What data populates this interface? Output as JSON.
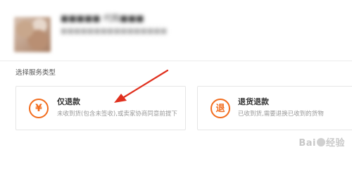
{
  "product": {
    "title": "■■■■■ 代购■■■",
    "spec": "■■■■■■■■■■■■■■■■"
  },
  "service_section": {
    "title": "选择服务类型"
  },
  "options": [
    {
      "icon": "refund-yen-icon",
      "icon_glyph": "¥",
      "title": "仅退款",
      "desc": "未收到货(包含未签收),或卖家协商同意前提下"
    },
    {
      "icon": "return-icon",
      "icon_glyph": "退",
      "title": "退货退款",
      "desc": "已收到货,需要退换已收到的货物"
    }
  ],
  "watermark": {
    "text_a": "Bai",
    "text_b": "经验"
  },
  "colors": {
    "accent": "#f26c1d",
    "annotation": "#e0301e"
  }
}
